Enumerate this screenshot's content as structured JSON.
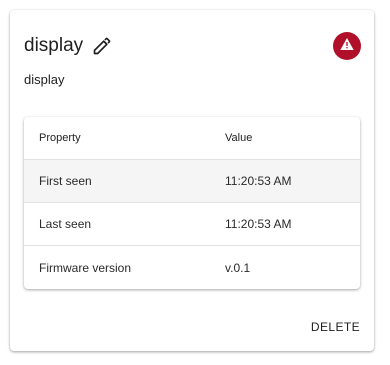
{
  "device": {
    "title": "display",
    "subtitle": "display",
    "edit_icon": "edit-pencil-icon",
    "status_icon": "warning-triangle-icon",
    "status_color": "#b0102a"
  },
  "table": {
    "headers": {
      "property": "Property",
      "value": "Value"
    },
    "rows": [
      {
        "property": "First seen",
        "value": "11:20:53 AM"
      },
      {
        "property": "Last seen",
        "value": "11:20:53 AM"
      },
      {
        "property": "Firmware version",
        "value": "v.0.1"
      }
    ]
  },
  "actions": {
    "delete_label": "DELETE"
  }
}
